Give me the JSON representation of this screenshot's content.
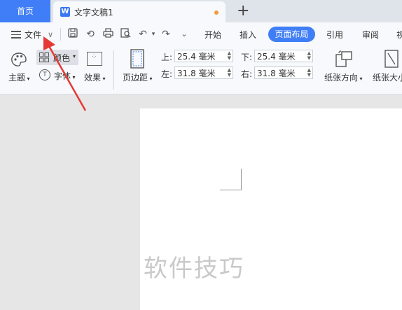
{
  "tabs": {
    "home_label": "首页",
    "doc_title": "文字文稿1",
    "new_tab": "+"
  },
  "menu": {
    "file_label": "文件",
    "items": [
      "开始",
      "插入",
      "页面布局",
      "引用",
      "审阅",
      "视"
    ],
    "active": "页面布局"
  },
  "ribbon": {
    "theme_label": "主题",
    "color_label": "颜色",
    "font_label": "字体",
    "effect_label": "效果",
    "margins_label": "页边距",
    "top_label": "上:",
    "top_value": "25.4 毫米",
    "bottom_label": "下:",
    "bottom_value": "25.4 毫米",
    "left_label": "左:",
    "left_value": "31.8 毫米",
    "right_label": "右:",
    "right_value": "31.8 毫米",
    "orientation_label": "纸张方向",
    "size_label": "纸张大小"
  },
  "watermark": "软件技巧",
  "colors": {
    "accent": "#3f7ef6",
    "arrow": "#e53935",
    "dot": "#f29b3a"
  }
}
